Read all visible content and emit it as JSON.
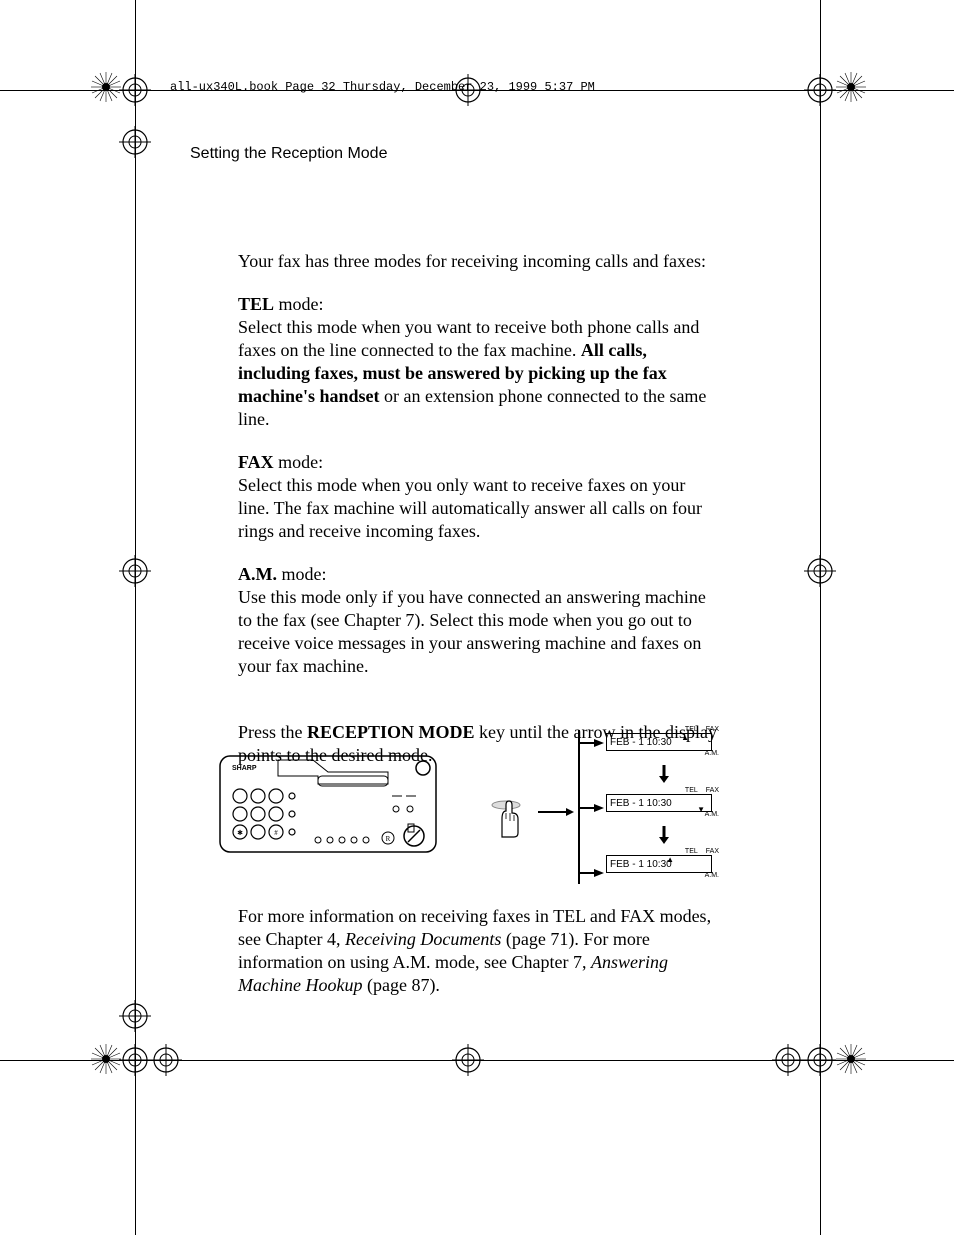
{
  "meta": {
    "header_line": "all-ux340L.book  Page 32  Thursday, December 23, 1999  5:37 PM"
  },
  "page": {
    "section_title": "Setting the Reception Mode",
    "intro": "Your fax has three modes for receiving incoming calls and faxes:",
    "tel_heading_bold": "TEL",
    "tel_heading_rest": " mode:",
    "tel_body_1": "Select this mode when you want to receive both phone calls and faxes on the line connected to the fax machine. ",
    "tel_body_bold": "All calls, including faxes, must be answered by picking up the fax machine's handset",
    "tel_body_2": " or an extension phone connected to the same line.",
    "fax_heading_bold": "FAX",
    "fax_heading_rest": " mode:",
    "fax_body": "Select this mode when you only want to receive faxes on your line. The fax machine will automatically answer all calls on four rings and receive incoming faxes.",
    "am_heading_bold": "A.M.",
    "am_heading_rest": " mode:",
    "am_body": "Use this mode only if you have connected an answering machine to the fax (see Chapter 7). Select this mode when you go out to receive voice messages in your answering machine and faxes on your fax machine.",
    "press_1": "Press the ",
    "press_bold": "RECEPTION MODE",
    "press_2": " key until the arrow in the display points to the desired mode.",
    "footer_1": "For more information on receiving faxes in TEL and FAX modes, see Chapter 4, ",
    "footer_i1": "Receiving Documents",
    "footer_2": " (page 71). For more information on using A.M. mode, see Chapter 7, ",
    "footer_i2": "Answering Machine Hookup",
    "footer_3": " (page 87)."
  },
  "diagram": {
    "display_text": "FEB - 1  10:30",
    "tel_label": "TEL",
    "fax_label": "FAX",
    "am_label": "A.M."
  }
}
